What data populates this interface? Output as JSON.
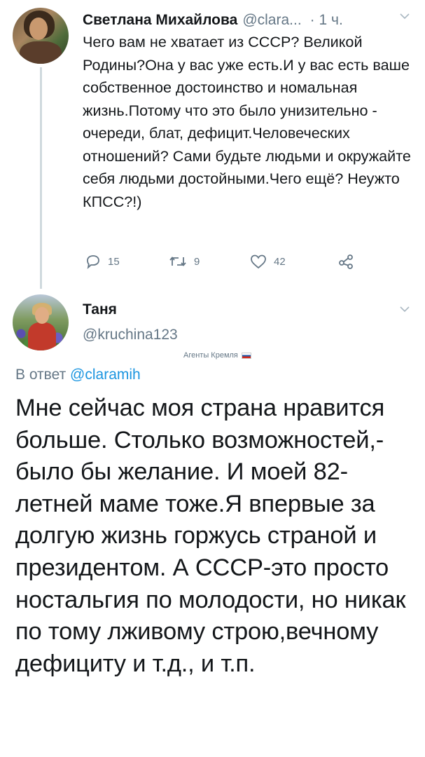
{
  "tweet1": {
    "author_name": "Светлана Михайлова",
    "author_handle": "@clara...",
    "timestamp": "· 1 ч.",
    "text": "Чего вам не хватает из СССР? Великой Родины?Она у вас уже есть.И у вас есть ваше собственное достоинство и номальная жизнь.Потому что это было унизительно - очереди, блат, дефицит.Человеческих отношений? Сами будьте людьми и окружайте себя людьми достойными.Чего ещё? Неужто КПСС?!)",
    "replies": "15",
    "retweets": "9",
    "likes": "42",
    "icons": [
      "reply-icon",
      "retweet-icon",
      "like-icon",
      "share-icon",
      "chevron-down-icon"
    ]
  },
  "tweet2": {
    "author_name": "Таня",
    "author_handle": "@kruchina123",
    "label": "Агенты Кремля",
    "reply_prefix": "В ответ",
    "reply_handle": "@claramih",
    "text": "Мне сейчас моя страна нравится больше. Столько возможностей,-было бы желание. И моей 82-летней маме тоже.Я впервые за долгую жизнь горжусь страной и президентом. А СССР-это просто ностальгия по молодости, но никак по тому лживому строю,вечному дефициту и т.д., и т.п."
  }
}
